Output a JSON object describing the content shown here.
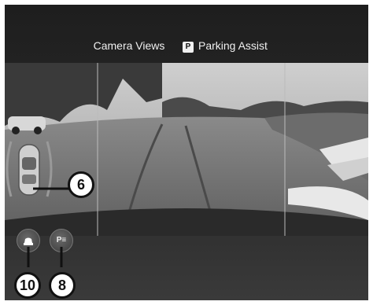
{
  "tabs": {
    "camera_views": "Camera Views",
    "parking_assist_badge": "P",
    "parking_assist": "Parking Assist"
  },
  "callouts": {
    "vehicle_symbol": "6",
    "lower_left_button": "10",
    "lower_right_button": "8"
  },
  "buttons": {
    "parking_sensors_icon": "P≡"
  },
  "icons": {
    "left_button": "camera-car-icon",
    "right_button": "parking-sensor-icon"
  }
}
